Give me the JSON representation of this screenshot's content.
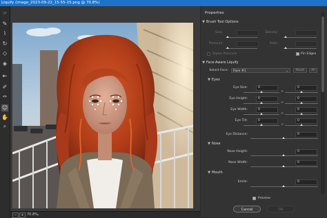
{
  "window": {
    "title": "Liquify (image_2023-09-22_15-55-15.png @ 70.8%)"
  },
  "tools": [
    {
      "name": "forward-warp-tool",
      "glyph": "☞",
      "active": false
    },
    {
      "name": "reconstruct-tool",
      "glyph": "✎",
      "active": false
    },
    {
      "name": "smooth-tool",
      "glyph": "⌇",
      "active": false
    },
    {
      "name": "twirl-clockwise-tool",
      "glyph": "↻",
      "active": false
    },
    {
      "name": "pucker-tool",
      "glyph": "◇",
      "active": false
    },
    {
      "name": "bloat-tool",
      "glyph": "◈",
      "active": false
    },
    {
      "name": "push-left-tool",
      "glyph": "⇤",
      "active": false
    },
    {
      "name": "freeze-mask-tool",
      "glyph": "✐",
      "active": false
    },
    {
      "name": "thaw-mask-tool",
      "glyph": "✑",
      "active": false
    },
    {
      "name": "face-tool",
      "glyph": "☺",
      "active": true
    },
    {
      "name": "hand-tool",
      "glyph": "✋",
      "active": false
    },
    {
      "name": "zoom-tool",
      "glyph": "⌕",
      "active": false
    }
  ],
  "status": {
    "zoom": "70.8%",
    "caret": "⌄",
    "minus": "−",
    "plus": "+"
  },
  "panel": {
    "title": "Properties",
    "brush": {
      "header": "Brush Tool Options",
      "size_label": "Size:",
      "density_label": "Density:",
      "pressure_label": "Pressure:",
      "rate_label": "Rate:",
      "stylus_label": "Stylus Pressure",
      "pin_edges_label": "Pin Edges"
    },
    "face": {
      "header": "Face-Aware Liquify",
      "select_face_label": "Select Face:",
      "select_face_value": "Face #1",
      "reset_label": "Reset",
      "all_label": "All",
      "eyes_header": "Eyes",
      "eye_size_label": "Eye Size:",
      "eye_height_label": "Eye Height:",
      "eye_width_label": "Eye Width:",
      "eye_tilt_label": "Eye Tilt:",
      "eye_distance_label": "Eye Distance:",
      "eye_values": {
        "size_l": "0",
        "size_r": "0",
        "height_l": "0",
        "height_r": "0",
        "width_l": "0",
        "width_r": "0",
        "tilt_l": "0",
        "tilt_r": "0",
        "distance": "0"
      },
      "nose_header": "Nose",
      "nose_height_label": "Nose Height:",
      "nose_width_label": "Nose Width:",
      "nose_values": {
        "height": "0",
        "width": "0"
      },
      "mouth_header": "Mouth",
      "smile_label": "Smile:",
      "smile_value": "0"
    },
    "preview_label": "Preview",
    "cancel_label": "Cancel",
    "ok_label": "OK"
  }
}
